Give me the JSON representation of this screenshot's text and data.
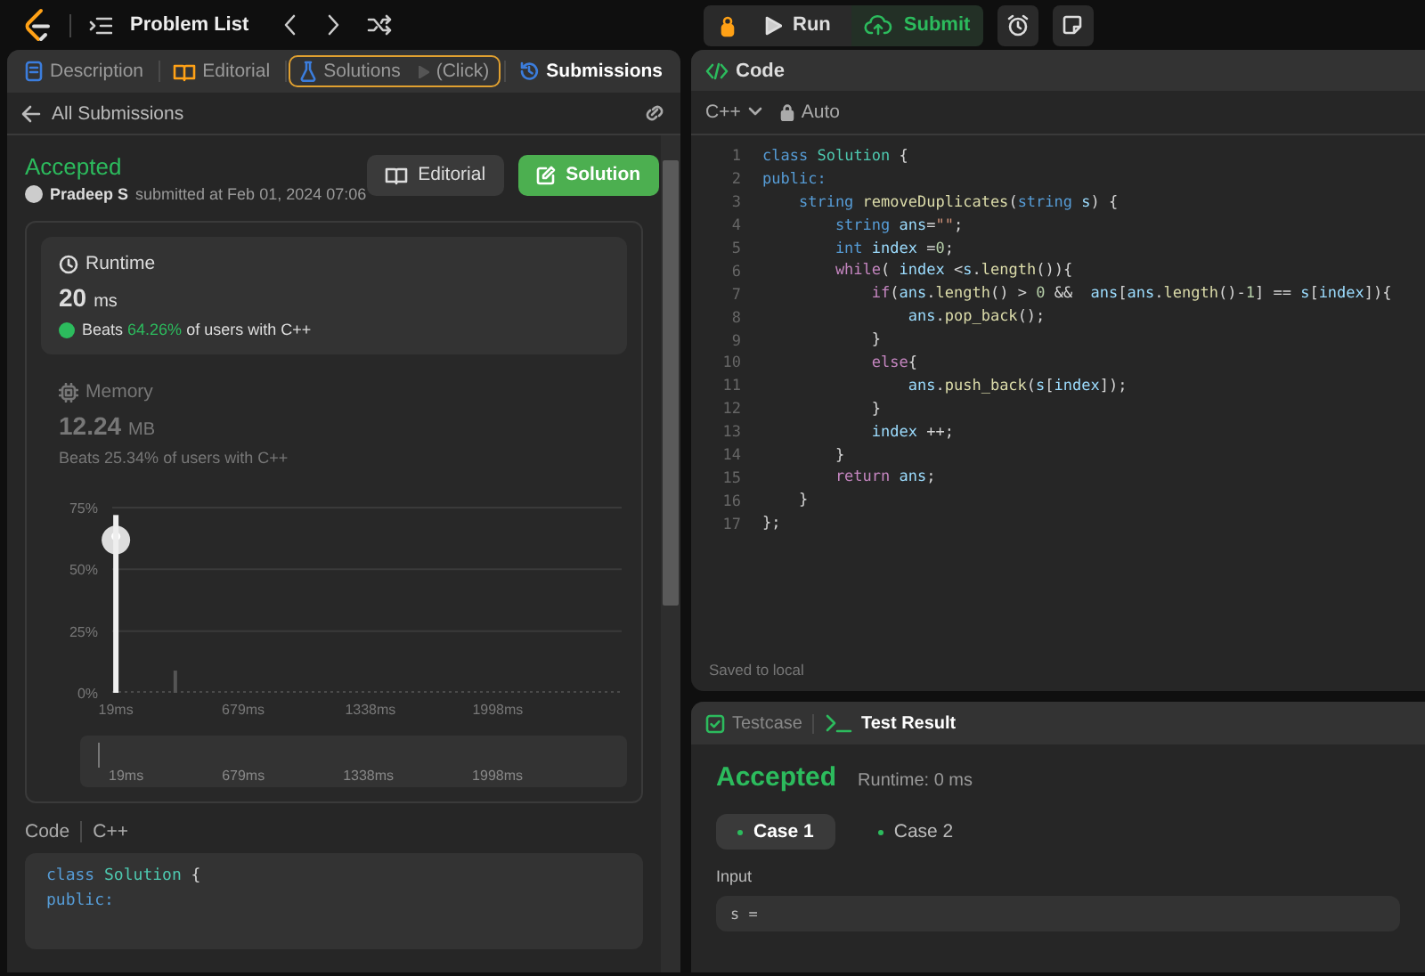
{
  "topbar": {
    "title": "Problem List",
    "actions": [
      {
        "kind": "debug"
      },
      {
        "kind": "run",
        "label": "Run"
      },
      {
        "kind": "submit",
        "label": "Submit"
      },
      {
        "kind": "alarm"
      },
      {
        "kind": "note"
      }
    ]
  },
  "submission_panel": {
    "tabs": [
      {
        "kind": "doc",
        "label": "Description",
        "selected": false,
        "highlighted": false
      },
      {
        "kind": "book",
        "label": "Editorial",
        "selected": false,
        "highlighted": false
      },
      {
        "kind": "flask",
        "label": "Solutions",
        "hint": "(Click)",
        "selected": false,
        "highlighted": true
      },
      {
        "kind": "history",
        "label": "Submissions",
        "selected": true,
        "highlighted": false
      }
    ],
    "back_link": "All Submissions",
    "status": "Accepted",
    "author": "Pradeep S",
    "submitted": "submitted at Feb 01, 2024 07:06",
    "buttons": [
      {
        "kind": "secondary",
        "label": "Editorial"
      },
      {
        "kind": "primary",
        "label": "Solution"
      }
    ],
    "stats": [
      {
        "kind": "clock",
        "title": "Runtime",
        "value": "20",
        "unit": "ms",
        "beats": "Beats",
        "percent": "64.26%",
        "suffix": "of users with C++",
        "selected": true
      },
      {
        "kind": "chip",
        "title": "Memory",
        "value": "12.24",
        "unit": "MB",
        "beats": "Beats",
        "percent": "25.34%",
        "suffix": "of users with C++",
        "selected": false
      }
    ],
    "chart_data": {
      "type": "bar",
      "x": [
        19,
        327
      ],
      "series": [
        {
          "color": "#eeeeee",
          "values": [
            72,
            null
          ]
        },
        {
          "color": "#555555",
          "values": [
            null,
            9
          ]
        }
      ],
      "xlim": [
        0,
        2640
      ],
      "ylim": [
        0,
        75
      ],
      "xticks": [
        {
          "value": 19,
          "label": "19ms"
        },
        {
          "value": 679,
          "label": "679ms"
        },
        {
          "value": 1338,
          "label": "1338ms"
        },
        {
          "value": 1998,
          "label": "1998ms"
        }
      ],
      "yticks": [
        {
          "value": 0,
          "label": "0%"
        },
        {
          "value": 25,
          "label": "25%"
        },
        {
          "value": 50,
          "label": "50%"
        },
        {
          "value": 75,
          "label": "75%"
        }
      ]
    },
    "range_selector": {
      "labels": [
        "19ms",
        "679ms",
        "1338ms",
        "1998ms"
      ]
    },
    "code_label": "Code",
    "code_language": "C++",
    "code_lines": [
      [
        {
          "kind": "keyword",
          "text": "class "
        },
        {
          "kind": "type",
          "text": "Solution"
        },
        {
          "kind": "plain",
          "text": " {"
        }
      ],
      [
        {
          "kind": "keyword",
          "text": "public:"
        }
      ]
    ]
  },
  "editor": {
    "title": "Code",
    "language": "C++",
    "mode": "Auto",
    "status": "Saved to local",
    "lines": [
      {
        "n": "1",
        "tokens": [
          {
            "kind": "keyword",
            "text": "class "
          },
          {
            "kind": "type",
            "text": "Solution"
          },
          {
            "kind": "plain",
            "text": " {"
          }
        ]
      },
      {
        "n": "2",
        "tokens": [
          {
            "kind": "keyword",
            "text": "public:"
          }
        ]
      },
      {
        "n": "3",
        "tokens": [
          {
            "kind": "keyword",
            "text": "    string "
          },
          {
            "kind": "function",
            "text": "removeDuplicates"
          },
          {
            "kind": "plain",
            "text": "("
          },
          {
            "kind": "keyword",
            "text": "string "
          },
          {
            "kind": "variable",
            "text": "s"
          },
          {
            "kind": "plain",
            "text": ") {"
          }
        ]
      },
      {
        "n": "4",
        "tokens": [
          {
            "kind": "keyword",
            "text": "        string "
          },
          {
            "kind": "variable",
            "text": "ans"
          },
          {
            "kind": "plain",
            "text": "="
          },
          {
            "kind": "string",
            "text": "\"\""
          },
          {
            "kind": "plain",
            "text": ";"
          }
        ]
      },
      {
        "n": "5",
        "tokens": [
          {
            "kind": "keyword",
            "text": "        int "
          },
          {
            "kind": "variable",
            "text": "index"
          },
          {
            "kind": "plain",
            "text": " ="
          },
          {
            "kind": "number",
            "text": "0"
          },
          {
            "kind": "plain",
            "text": ";"
          }
        ]
      },
      {
        "n": "6",
        "tokens": [
          {
            "kind": "control",
            "text": "        while"
          },
          {
            "kind": "plain",
            "text": "( "
          },
          {
            "kind": "variable",
            "text": "index"
          },
          {
            "kind": "plain",
            "text": " <"
          },
          {
            "kind": "variable",
            "text": "s"
          },
          {
            "kind": "plain",
            "text": "."
          },
          {
            "kind": "function",
            "text": "length"
          },
          {
            "kind": "plain",
            "text": "()){"
          }
        ]
      },
      {
        "n": "7",
        "tokens": [
          {
            "kind": "control",
            "text": "            if"
          },
          {
            "kind": "plain",
            "text": "("
          },
          {
            "kind": "variable",
            "text": "ans"
          },
          {
            "kind": "plain",
            "text": "."
          },
          {
            "kind": "function",
            "text": "length"
          },
          {
            "kind": "plain",
            "text": "() > "
          },
          {
            "kind": "number",
            "text": "0"
          },
          {
            "kind": "plain",
            "text": " &&  "
          },
          {
            "kind": "variable",
            "text": "ans"
          },
          {
            "kind": "plain",
            "text": "["
          },
          {
            "kind": "variable",
            "text": "ans"
          },
          {
            "kind": "plain",
            "text": "."
          },
          {
            "kind": "function",
            "text": "length"
          },
          {
            "kind": "plain",
            "text": "()-"
          },
          {
            "kind": "number",
            "text": "1"
          },
          {
            "kind": "plain",
            "text": "] == "
          },
          {
            "kind": "variable",
            "text": "s"
          },
          {
            "kind": "plain",
            "text": "["
          },
          {
            "kind": "variable",
            "text": "index"
          },
          {
            "kind": "plain",
            "text": "]){"
          }
        ]
      },
      {
        "n": "8",
        "tokens": [
          {
            "kind": "variable",
            "text": "                ans"
          },
          {
            "kind": "plain",
            "text": "."
          },
          {
            "kind": "function",
            "text": "pop_back"
          },
          {
            "kind": "plain",
            "text": "();"
          }
        ]
      },
      {
        "n": "9",
        "tokens": [
          {
            "kind": "plain",
            "text": "            }"
          }
        ]
      },
      {
        "n": "10",
        "tokens": [
          {
            "kind": "control",
            "text": "            else"
          },
          {
            "kind": "plain",
            "text": "{"
          }
        ]
      },
      {
        "n": "11",
        "tokens": [
          {
            "kind": "variable",
            "text": "                ans"
          },
          {
            "kind": "plain",
            "text": "."
          },
          {
            "kind": "function",
            "text": "push_back"
          },
          {
            "kind": "plain",
            "text": "("
          },
          {
            "kind": "variable",
            "text": "s"
          },
          {
            "kind": "plain",
            "text": "["
          },
          {
            "kind": "variable",
            "text": "index"
          },
          {
            "kind": "plain",
            "text": "]);"
          }
        ]
      },
      {
        "n": "12",
        "tokens": [
          {
            "kind": "plain",
            "text": "            }"
          }
        ]
      },
      {
        "n": "13",
        "tokens": [
          {
            "kind": "variable",
            "text": "            index"
          },
          {
            "kind": "plain",
            "text": " ++;"
          }
        ]
      },
      {
        "n": "14",
        "tokens": [
          {
            "kind": "plain",
            "text": "        }"
          }
        ]
      },
      {
        "n": "15",
        "tokens": [
          {
            "kind": "control",
            "text": "        return"
          },
          {
            "kind": "variable",
            "text": " ans"
          },
          {
            "kind": "plain",
            "text": ";"
          }
        ]
      },
      {
        "n": "16",
        "tokens": [
          {
            "kind": "plain",
            "text": "    }"
          }
        ]
      },
      {
        "n": "17",
        "tokens": [
          {
            "kind": "plain",
            "text": "};"
          }
        ]
      }
    ]
  },
  "result": {
    "tabs": [
      {
        "kind": "check",
        "label": "Testcase",
        "selected": false
      },
      {
        "kind": "terminal",
        "label": "Test Result",
        "selected": true
      }
    ],
    "status": "Accepted",
    "runtime": "Runtime: 0 ms",
    "cases": [
      {
        "label": "Case 1",
        "selected": true
      },
      {
        "label": "Case 2",
        "selected": false
      }
    ],
    "input_label": "Input",
    "input_value": "s ="
  }
}
